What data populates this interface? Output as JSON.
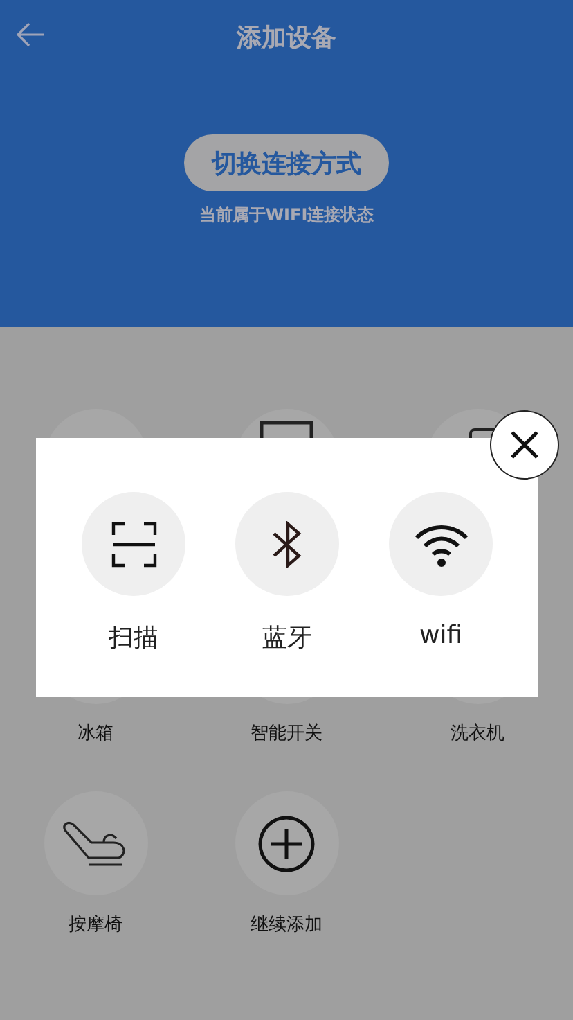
{
  "header": {
    "title": "添加设备",
    "switch_button": "切换连接方式",
    "status": "当前属于WIFI连接状态"
  },
  "devices": [
    {
      "kind": "blank"
    },
    {
      "kind": "panel"
    },
    {
      "kind": "washer"
    },
    {
      "kind": "blank",
      "label": "冰箱"
    },
    {
      "kind": "blank",
      "label": "智能开关"
    },
    {
      "kind": "blank",
      "label": "洗衣机"
    },
    {
      "kind": "chair",
      "label": "按摩椅"
    },
    {
      "kind": "add",
      "label": "继续添加"
    }
  ],
  "dialog": {
    "options": [
      {
        "kind": "scan",
        "label": "扫描"
      },
      {
        "kind": "bluetooth",
        "label": "蓝牙"
      },
      {
        "kind": "wifi",
        "label": "wifi"
      }
    ]
  }
}
